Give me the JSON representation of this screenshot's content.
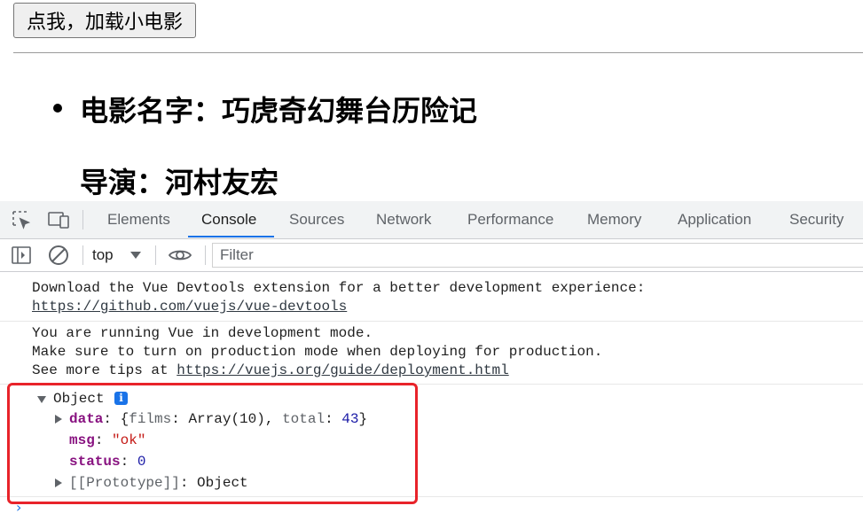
{
  "page": {
    "load_button": "点我，加载小电影",
    "movie_name": "电影名字：巧虎奇幻舞台历险记",
    "director": "导演：河村友宏"
  },
  "devtools": {
    "tabs": [
      "Elements",
      "Console",
      "Sources",
      "Network",
      "Performance",
      "Memory",
      "Application",
      "Security"
    ],
    "active_tab": "Console",
    "icons": {
      "inspect": "inspect-element-icon",
      "device": "device-toolbar-icon",
      "sidebar": "sidebar-toggle-icon",
      "clear": "clear-console-icon",
      "eye": "live-expression-eye-icon"
    },
    "context": "top",
    "filter_placeholder": "Filter",
    "accent_color": "#1a73e8"
  },
  "console": {
    "msg1_line1": "Download the Vue Devtools extension for a better development experience:",
    "msg1_link": "https://github.com/vuejs/vue-devtools",
    "msg2_line1": "You are running Vue in development mode.",
    "msg2_line2": "Make sure to turn on production mode when deploying for production.",
    "msg2_line3_prefix": "See more tips at ",
    "msg2_link": "https://vuejs.org/guide/deployment.html",
    "object": {
      "label": "Object",
      "info": "i",
      "data_key": "data",
      "data_value_open": "{",
      "films_key": "films",
      "films_value": "Array(10)",
      "total_key": "total",
      "total_value": "43",
      "data_value_close": "}",
      "msg_key": "msg",
      "msg_value": "\"ok\"",
      "status_key": "status",
      "status_value": "0",
      "proto_key": "[[Prototype]]",
      "proto_value": "Object"
    },
    "prompt": "›",
    "highlight_color": "#e8232a"
  }
}
